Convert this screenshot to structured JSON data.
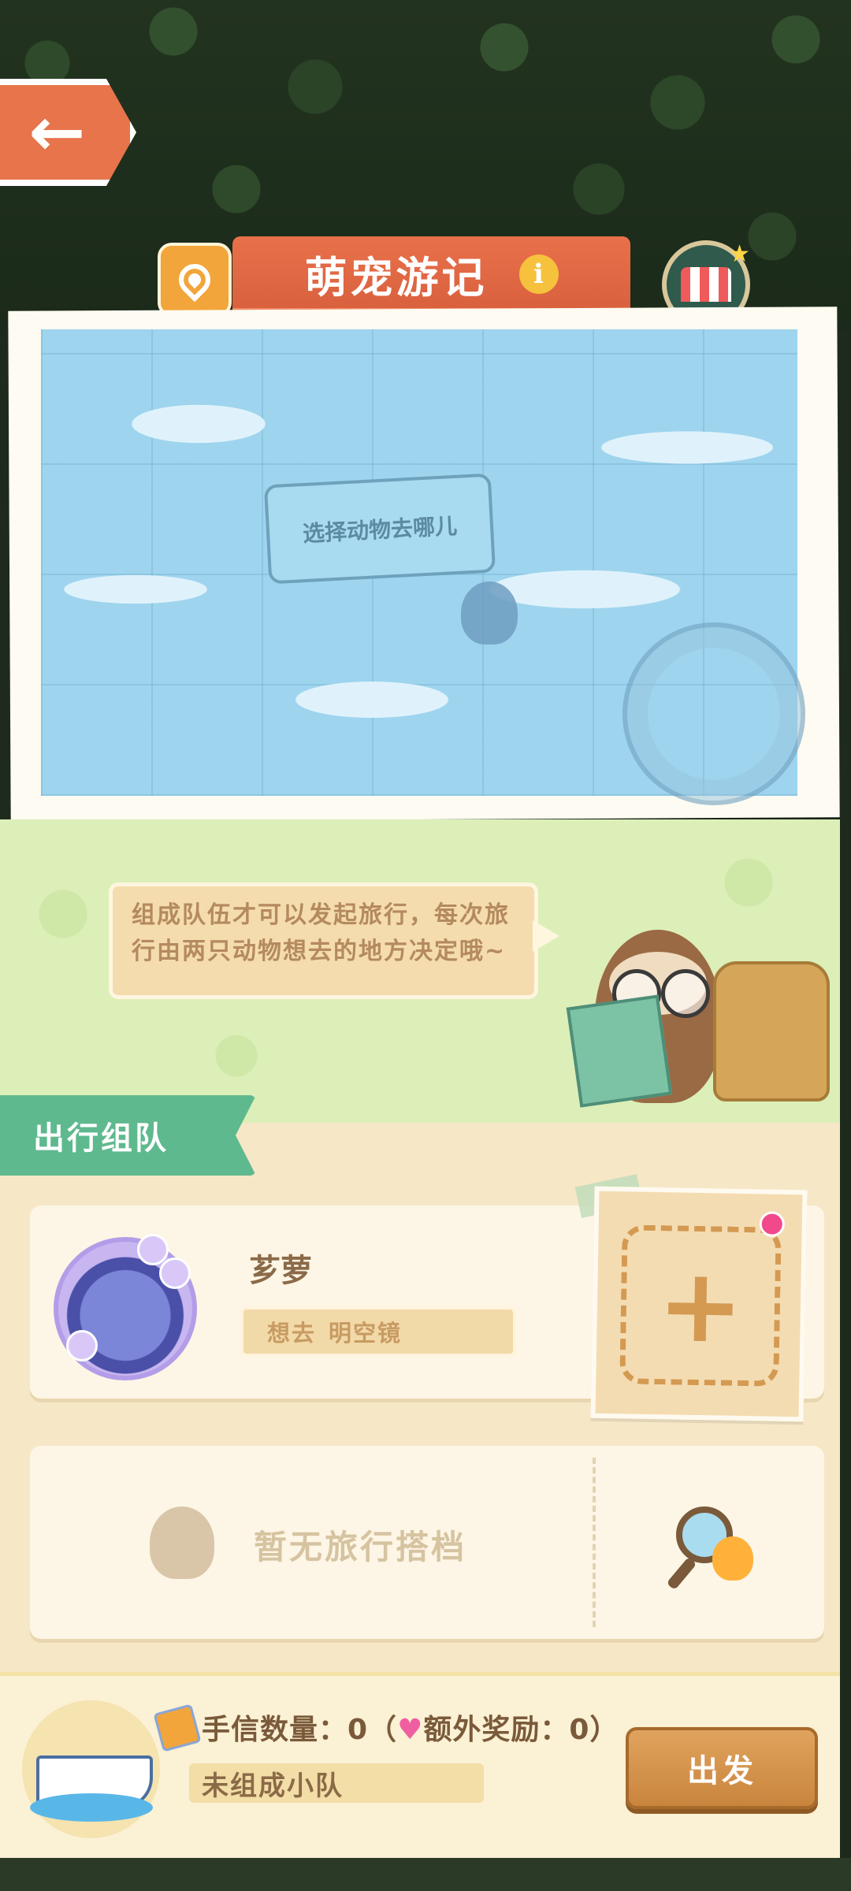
{
  "header": {
    "title": "萌宠游记",
    "info_icon": "i"
  },
  "map": {
    "bubble_text": "选择动物去哪儿"
  },
  "guide": {
    "tip_text": "组成队伍才可以发起旅行，每次旅行由两只动物想去的地方决定哦~"
  },
  "team": {
    "section_label": "出行组队",
    "member": {
      "name": "芗萝",
      "wish_label": "想去",
      "wish_place": "明空镜"
    },
    "add_symbol": "+",
    "no_partner_text": "暂无旅行搭档"
  },
  "footer": {
    "letter_count_text": "手信数量：0（",
    "heart_symbol": "♥",
    "extra_reward_text": "额外奖励：0）",
    "team_status": "未组成小队",
    "depart_label": "出发"
  },
  "colors": {
    "accent_orange": "#e7744b",
    "team_green": "#5fb98e",
    "button_brown": "#c9853e"
  },
  "icons": [
    "back-arrow-icon",
    "map-pin-icon",
    "info-icon",
    "shop-icon",
    "plus-icon",
    "search-icon",
    "ship-icon",
    "letter-icon",
    "heart-icon"
  ]
}
